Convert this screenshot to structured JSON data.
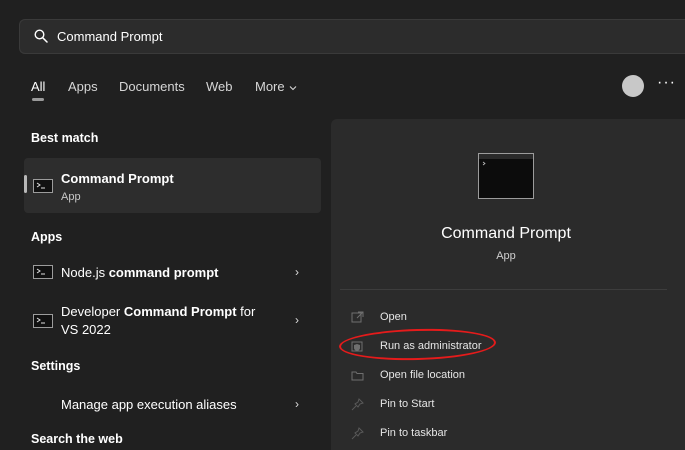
{
  "search": {
    "value": "Command Prompt"
  },
  "tabs": [
    {
      "label": "All"
    },
    {
      "label": "Apps"
    },
    {
      "label": "Documents"
    },
    {
      "label": "Web"
    },
    {
      "label": "More"
    }
  ],
  "header": {
    "more_dots": "···"
  },
  "left": {
    "best_match_heading": "Best match",
    "best_match": {
      "title": "Command Prompt",
      "subtitle": "App"
    },
    "apps_heading": "Apps",
    "apps": [
      {
        "pre": "Node.js ",
        "bold": "command prompt",
        "post": ""
      },
      {
        "pre": "Developer ",
        "bold": "Command Prompt",
        "post": " for",
        "line2": "VS 2022"
      }
    ],
    "settings_heading": "Settings",
    "settings": [
      {
        "label": "Manage app execution aliases"
      }
    ],
    "web_heading": "Search the web",
    "arrow": "›"
  },
  "preview": {
    "title": "Command Prompt",
    "subtitle": "App",
    "actions": [
      {
        "label": "Open",
        "icon": "open-external-icon"
      },
      {
        "label": "Run as administrator",
        "icon": "shield-admin-icon"
      },
      {
        "label": "Open file location",
        "icon": "folder-icon"
      },
      {
        "label": "Pin to Start",
        "icon": "pin-icon"
      },
      {
        "label": "Pin to taskbar",
        "icon": "pin-icon"
      }
    ]
  },
  "colors": {
    "background": "#202020",
    "panel": "#2b2b2b",
    "annotation_ring": "#e51b1b"
  }
}
